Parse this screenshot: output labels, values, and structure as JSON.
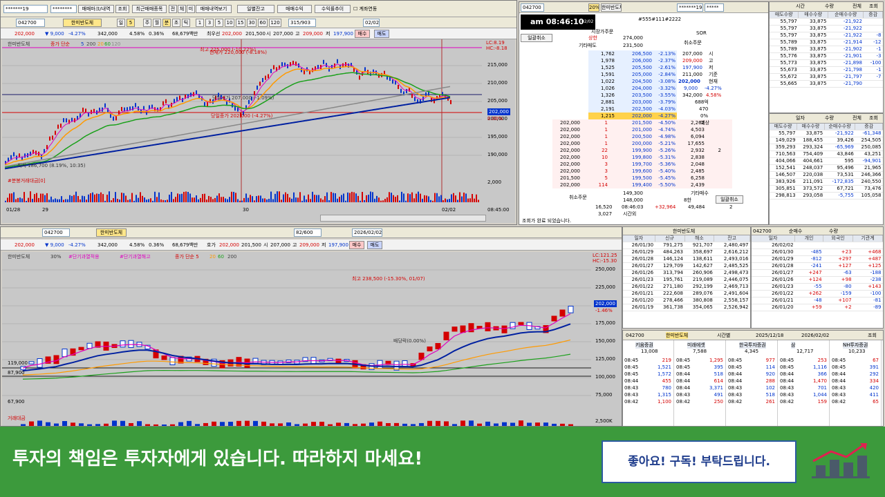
{
  "top_chart": {
    "code": "042700",
    "stock_name": "한미반도체",
    "menu_tabs": [
      "매매마크/내역",
      "조회",
      "최근매매종목",
      "전",
      "체",
      "미",
      "매매내역보기"
    ],
    "right_buttons": [
      "일별잔고",
      "매매수익",
      "수익률추이"
    ],
    "checkbox_label": "계좌연동",
    "account_mask": "*******19",
    "password_mask": "********",
    "price_row": [
      "202,000",
      "9,000",
      "-4.27%",
      "342,000",
      "4.58%",
      "0.36%",
      "68,679백만",
      "최우선",
      "202,000",
      "201,500",
      "시",
      "207,000",
      "고",
      "209,000",
      "저",
      "197,900"
    ],
    "buy_label": "매수",
    "sell_label": "매도",
    "count": "315/903",
    "date": "02/02",
    "periods": [
      "일",
      "5",
      "주",
      "월",
      "분",
      "초",
      "틱",
      "1",
      "3",
      "5",
      "10",
      "15",
      "30",
      "60",
      "120"
    ],
    "legend": [
      "한미반도체",
      "종가 단순",
      "5",
      "200",
      "20",
      "60",
      "120"
    ],
    "overlay_labels": [
      "최고 225,000 (-10.22%)",
      "현재가 220,000 (-8.18%)",
      "당일시가 207,000 (-1.09%)",
      "당일종가 202,000 (-4.27%)",
      "최저 186,700 (8.19%, 10:35)"
    ],
    "y_ticks": [
      "215,000",
      "210,000",
      "205,000",
      "200,000",
      "195,000",
      "190,000"
    ],
    "price_tag": "202,000",
    "pct_tag": "0.00%",
    "lc_hc": [
      "LC:8.19",
      "HC:-8.18"
    ],
    "x_ticks": [
      "01/28",
      "29",
      "30",
      "02/02"
    ],
    "vol_label": "#분봉거래대금[0]",
    "vol_tick": "2,000",
    "time_tag": "08:45:00"
  },
  "orderbook": {
    "clock": "am 08:46:10",
    "clock_date": "02/02 월",
    "code": "042700",
    "name": "한미반도체",
    "tab_20": "20%",
    "account": "#555#111#2222",
    "fields": [
      "*******19",
      "*****"
    ],
    "header_labels": [
      "일괄취소",
      "상한",
      "기타매도",
      "시장가주문",
      "SOR"
    ],
    "upper_limit": "274,000",
    "lower_row": "231,500",
    "asks": [
      {
        "qty": "1,762",
        "price": "206,500",
        "pct": "-2.13%"
      },
      {
        "qty": "1,978",
        "price": "206,000",
        "pct": "-2.37%"
      },
      {
        "qty": "1,525",
        "price": "205,500",
        "pct": "-2.61%"
      },
      {
        "qty": "1,591",
        "price": "205,000",
        "pct": "-2.84%"
      },
      {
        "qty": "1,022",
        "price": "204,500",
        "pct": "-3.08%"
      },
      {
        "qty": "1,026",
        "price": "204,000",
        "pct": "-3.32%"
      },
      {
        "qty": "1,326",
        "price": "203,500",
        "pct": "-3.55%"
      },
      {
        "qty": "2,881",
        "price": "203,000",
        "pct": "-3.79%"
      },
      {
        "qty": "2,191",
        "price": "202,500",
        "pct": "-4.03%"
      },
      {
        "qty": "1,215",
        "price": "202,000",
        "pct": "-4.27%"
      }
    ],
    "bids": [
      {
        "side": "202,000",
        "n": "1",
        "price": "201,500",
        "pct": "-4.50%",
        "qty": "2,262",
        "x": ""
      },
      {
        "side": "202,000",
        "n": "1",
        "price": "201,000",
        "pct": "-4.74%",
        "qty": "4,503",
        "x": ""
      },
      {
        "side": "202,000",
        "n": "1",
        "price": "200,500",
        "pct": "-4.98%",
        "qty": "6,094",
        "x": ""
      },
      {
        "side": "202,000",
        "n": "1",
        "price": "200,000",
        "pct": "-5.21%",
        "qty": "17,655",
        "x": ""
      },
      {
        "side": "202,000",
        "n": "22",
        "price": "199,900",
        "pct": "-5.26%",
        "qty": "2,932",
        "x": "2"
      },
      {
        "side": "202,000",
        "n": "10",
        "price": "199,800",
        "pct": "-5.31%",
        "qty": "2,838",
        "x": ""
      },
      {
        "side": "202,000",
        "n": "3",
        "price": "199,700",
        "pct": "-5.36%",
        "qty": "2,048",
        "x": ""
      },
      {
        "side": "202,000",
        "n": "3",
        "price": "199,600",
        "pct": "-5.40%",
        "qty": "2,485",
        "x": ""
      },
      {
        "side": "201,500",
        "n": "5",
        "price": "199,500",
        "pct": "-5.45%",
        "qty": "6,258",
        "x": ""
      },
      {
        "side": "202,000",
        "n": "114",
        "price": "199,400",
        "pct": "-5.50%",
        "qty": "2,439",
        "x": ""
      }
    ],
    "side_info": [
      "취소주문",
      "207,000",
      "209,000",
      "197,900",
      "211,000",
      "202,000",
      "9,000",
      "342,000",
      "688억",
      "470",
      "0%",
      "예상"
    ],
    "side_info_labels": [
      "시",
      "고",
      "저",
      "기준",
      "현재",
      "-4.27%",
      "4.58%"
    ],
    "footer": [
      "16,520",
      "08:46:03",
      "+32,964",
      "49,484",
      "2",
      "3,027",
      "시간외"
    ],
    "footer_labels": [
      "취소주문",
      "149,300",
      "148,000",
      "기타매수",
      "8한",
      "일괄취소"
    ],
    "status": "조회가 완료 되었습니다."
  },
  "right_top": {
    "header": [
      "매도수량",
      "매수수량",
      "순매수수량",
      "증감"
    ],
    "rows": [
      [
        "55,797",
        "33,875",
        "-21,922",
        ""
      ],
      [
        "55,797",
        "33,875",
        "-21,922",
        ""
      ],
      [
        "55,797",
        "33,875",
        "-21,922",
        "-8"
      ],
      [
        "55,789",
        "33,875",
        "-21,914",
        "-12"
      ],
      [
        "55,789",
        "33,875",
        "-21,902",
        "-1"
      ],
      [
        "55,776",
        "33,875",
        "-21,901",
        "-3"
      ],
      [
        "55,773",
        "33,875",
        "-21,898",
        "-100"
      ],
      [
        "55,673",
        "33,875",
        "-21,798",
        "-1"
      ],
      [
        "55,672",
        "33,875",
        "-21,797",
        "-7"
      ],
      [
        "55,665",
        "33,875",
        "-21,790",
        ""
      ]
    ],
    "select": "시간",
    "sub": "수량",
    "all": "전체",
    "query": "조회"
  },
  "right_mid": {
    "header": [
      "매도수량",
      "매수수량",
      "순매수수량",
      "증감"
    ],
    "rows": [
      [
        "55,797",
        "33,875",
        "-21,922",
        "-61,348"
      ],
      [
        "149,029",
        "188,455",
        "39,426",
        "254,505"
      ],
      [
        "359,293",
        "293,324",
        "-65,969",
        "250,085"
      ],
      [
        "710,563",
        "754,409",
        "43,846",
        "43,251"
      ],
      [
        "404,066",
        "404,661",
        "595",
        "-94,901"
      ],
      [
        "152,541",
        "248,037",
        "95,496",
        "21,965"
      ],
      [
        "146,507",
        "220,038",
        "73,531",
        "246,366"
      ],
      [
        "383,926",
        "211,091",
        "-172,835",
        "240,550"
      ],
      [
        "305,851",
        "373,572",
        "67,721",
        "73,476"
      ],
      [
        "298,813",
        "293,058",
        "-5,755",
        "105,058"
      ]
    ],
    "select": "일자",
    "sub": "수량",
    "all": "전체",
    "query": "조회"
  },
  "bottom_chart": {
    "code": "042700",
    "name": "한미반도체",
    "date": "2026/02/02",
    "count": "82/600",
    "legend": [
      "한미반도체",
      "30%",
      "#단기과열적용",
      "#단기과열해고",
      "종가 단순 5",
      "20",
      "60",
      "200"
    ],
    "price_row": [
      "202,000",
      "9,000",
      "-4.27%",
      "342,000",
      "4.58%",
      "0.36%",
      "68,679백만",
      "호가",
      "202,000",
      "201,500",
      "시",
      "207,000",
      "고",
      "209,000",
      "저",
      "197,900"
    ],
    "buy_label": "매수",
    "sell_label": "매도",
    "labels": [
      "최고 238,500 (-15.30%, 01/07)",
      "배당락(0.00%)",
      "LC:121.25",
      "HC:-15.30"
    ],
    "left_ticks": [
      "119,000",
      "87,900",
      "67,900"
    ],
    "y_ticks": [
      "250,000",
      "225,000",
      "200,000",
      "175,000",
      "150,000",
      "125,000",
      "100,000",
      "75,000"
    ],
    "price_tag": "202,000",
    "pct_tag": "-1.46%",
    "vol_label": "거래대금",
    "vol_tick": "2,500K"
  },
  "investor": {
    "name": "한미반도체",
    "header": [
      "일자",
      "신규",
      "해소",
      "잔고"
    ],
    "rows": [
      [
        "26/01/30",
        "791,275",
        "921,707",
        "2,480,497"
      ],
      [
        "26/01/29",
        "484,263",
        "358,697",
        "2,616,212"
      ],
      [
        "26/01/28",
        "146,124",
        "138,611",
        "2,493,016"
      ],
      [
        "26/01/27",
        "129,709",
        "142,627",
        "2,485,525"
      ],
      [
        "26/01/26",
        "313,794",
        "260,906",
        "2,498,473"
      ],
      [
        "26/01/23",
        "195,761",
        "219,089",
        "2,446,075"
      ],
      [
        "26/01/22",
        "271,180",
        "292,199",
        "2,469,713"
      ],
      [
        "26/01/21",
        "222,608",
        "289,076",
        "2,491,604"
      ],
      [
        "26/01/20",
        "278,466",
        "380,808",
        "2,558,157"
      ],
      [
        "26/01/19",
        "361,738",
        "354,065",
        "2,526,942"
      ]
    ]
  },
  "foreign": {
    "code": "042700",
    "select": "순매수",
    "sub": "수량",
    "header": [
      "일자",
      "개인",
      "외국인",
      "기관계"
    ],
    "rows": [
      [
        "26/02/02",
        "",
        "",
        ""
      ],
      [
        "26/01/30",
        "-485",
        "+23",
        "+468"
      ],
      [
        "26/01/29",
        "-812",
        "+297",
        "+487"
      ],
      [
        "26/01/28",
        "-241",
        "+127",
        "+125"
      ],
      [
        "26/01/27",
        "+247",
        "-63",
        "-188"
      ],
      [
        "26/01/26",
        "+124",
        "+98",
        "-238"
      ],
      [
        "26/01/23",
        "-55",
        "-80",
        "+143"
      ],
      [
        "26/01/22",
        "+262",
        "-159",
        "-100"
      ],
      [
        "26/01/21",
        "-48",
        "+107",
        "-81"
      ],
      [
        "26/01/20",
        "+59",
        "+2",
        "-89"
      ]
    ]
  },
  "broker": {
    "code": "042700",
    "name": "한미반도체",
    "mode": "시간별",
    "date_from": "2025/12/18",
    "date_to": "2026/02/02",
    "query": "조회",
    "cols": [
      {
        "name": "키움증권",
        "total": "13,008",
        "rows": [
          [
            "08:45",
            "219"
          ],
          [
            "08:45",
            "1,521"
          ],
          [
            "08:45",
            "1,572"
          ],
          [
            "08:44",
            "455"
          ],
          [
            "08:43",
            "780"
          ],
          [
            "08:43",
            "1,315"
          ],
          [
            "08:42",
            "1,100"
          ]
        ]
      },
      {
        "name": "미래에셋",
        "total": "7,588",
        "rows": [
          [
            "08:45",
            "1,295"
          ],
          [
            "08:45",
            "395"
          ],
          [
            "08:44",
            "518"
          ],
          [
            "08:44",
            "614"
          ],
          [
            "08:44",
            "3,371"
          ],
          [
            "08:43",
            "491"
          ],
          [
            "08:42",
            "250"
          ]
        ]
      },
      {
        "name": "한국투자증권",
        "total": "4,345",
        "rows": [
          [
            "08:45",
            "977"
          ],
          [
            "08:45",
            "114"
          ],
          [
            "08:44",
            "920"
          ],
          [
            "08:44",
            "288"
          ],
          [
            "08:43",
            "102"
          ],
          [
            "08:43",
            "518"
          ],
          [
            "08:42",
            "261"
          ]
        ]
      },
      {
        "name": "삼",
        "total": "12,717",
        "rows": [
          [
            "08:45",
            "253"
          ],
          [
            "08:45",
            "1,116"
          ],
          [
            "08:44",
            "366"
          ],
          [
            "08:44",
            "1,470"
          ],
          [
            "08:43",
            "701"
          ],
          [
            "08:43",
            "1,044"
          ],
          [
            "08:42",
            "159"
          ]
        ]
      },
      {
        "name": "NH투자증권",
        "total": "10,233",
        "rows": [
          [
            "08:45",
            "67"
          ],
          [
            "08:45",
            "391"
          ],
          [
            "08:44",
            "292"
          ],
          [
            "08:44",
            "334"
          ],
          [
            "08:43",
            "420"
          ],
          [
            "08:43",
            "411"
          ],
          [
            "08:42",
            "65"
          ]
        ]
      }
    ]
  },
  "banner": {
    "disclaimer": "투자의 책임은 투자자에게 있습니다. 따라하지 마세요!",
    "cta": "좋아요! 구독! 부탁드립니다."
  },
  "colors": {
    "banner": "#3c9a3c",
    "chart_bg": "#c8c8c8",
    "up": "#d40000",
    "down": "#0033cc",
    "ma_orange": "#ff9a00",
    "ma_green": "#1aa01a",
    "ma_gray": "#888888",
    "ma_blue": "#0020a0",
    "ma_magenta": "#e000c0"
  }
}
